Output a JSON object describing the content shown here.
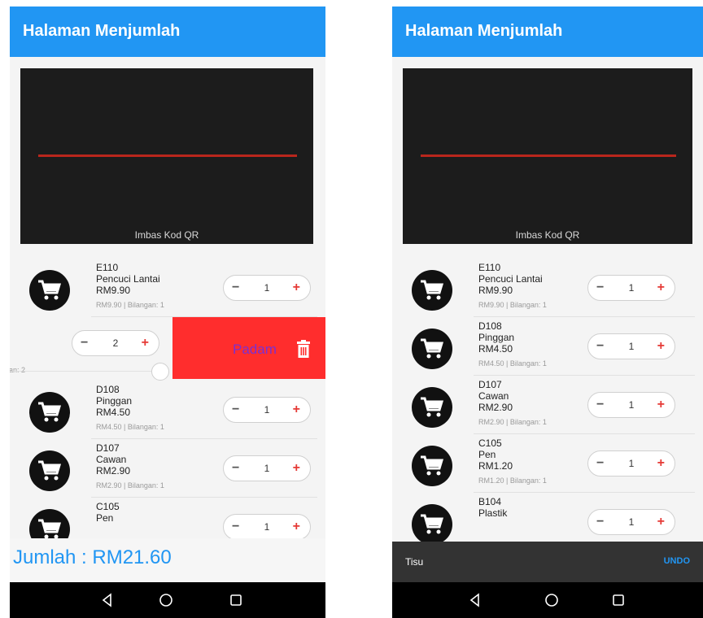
{
  "screen1": {
    "app_title": "Halaman Menjumlah",
    "scanner_label": "Imbas Kod QR",
    "items": [
      {
        "code": "E110",
        "name": "Pencuci Lantai",
        "price": "RM9.90",
        "subline": "RM9.90 | Bilangan: 1",
        "qty": "1"
      },
      {
        "code": "D108",
        "name": "Pinggan",
        "price": "RM4.50",
        "subline": "RM4.50 | Bilangan: 1",
        "qty": "1"
      },
      {
        "code": "D107",
        "name": "Cawan",
        "price": "RM2.90",
        "subline": "RM2.90 | Bilangan: 1",
        "qty": "1"
      },
      {
        "code": "C105",
        "name": "Pen",
        "price": "",
        "subline": "",
        "qty": "1"
      }
    ],
    "swiped_item": {
      "qty": "2",
      "subline_fragment": "gan: 2",
      "delete_label": "Padam"
    },
    "total": "Jumlah : RM21.60"
  },
  "screen2": {
    "app_title": "Halaman Menjumlah",
    "scanner_label": "Imbas Kod QR",
    "items": [
      {
        "code": "E110",
        "name": "Pencuci Lantai",
        "price": "RM9.90",
        "subline": "RM9.90 | Bilangan: 1",
        "qty": "1"
      },
      {
        "code": "D108",
        "name": "Pinggan",
        "price": "RM4.50",
        "subline": "RM4.50 | Bilangan: 1",
        "qty": "1"
      },
      {
        "code": "D107",
        "name": "Cawan",
        "price": "RM2.90",
        "subline": "RM2.90 | Bilangan: 1",
        "qty": "1"
      },
      {
        "code": "C105",
        "name": "Pen",
        "price": "RM1.20",
        "subline": "RM1.20 | Bilangan: 1",
        "qty": "1"
      },
      {
        "code": "B104",
        "name": "Plastik",
        "price": "",
        "subline": "",
        "qty": "1"
      }
    ],
    "snackbar": {
      "message": "Tisu",
      "action": "UNDO"
    }
  },
  "stepper": {
    "minus": "−",
    "plus": "+"
  },
  "icons": {
    "item": "shopping-cart-icon",
    "delete": "trash-icon",
    "nav": [
      "back-icon",
      "home-icon",
      "recent-apps-icon"
    ]
  },
  "colors": {
    "app_bar": "#2196f3",
    "delete_panel": "#ff2d2d",
    "scan_line": "#b9261c",
    "total_text": "#2196f3"
  }
}
